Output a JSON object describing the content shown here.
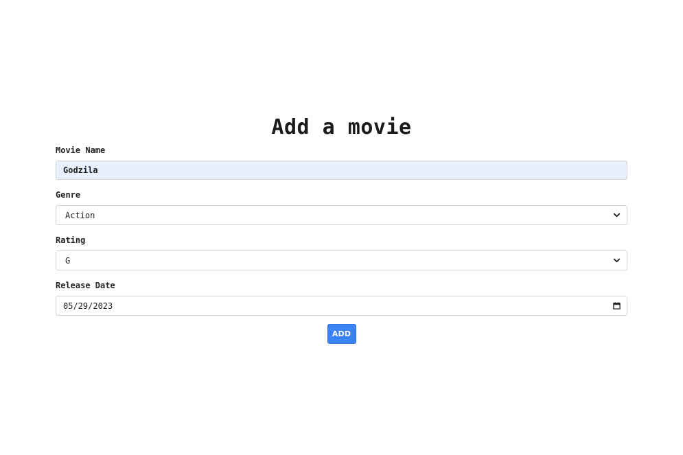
{
  "form": {
    "title": "Add a movie",
    "movie_name": {
      "label": "Movie Name",
      "value": "Godzila"
    },
    "genre": {
      "label": "Genre",
      "selected": "Action"
    },
    "rating": {
      "label": "Rating",
      "selected": "G"
    },
    "release_date": {
      "label": "Release Date",
      "value": "05/29/2023"
    },
    "submit_label": "ADD"
  },
  "icons": {
    "genre_dropdown": "chevron-down-icon",
    "rating_dropdown": "chevron-down-icon",
    "date_picker": "calendar-icon"
  },
  "colors": {
    "accent": "#3b82f6",
    "autofill_bg": "#e8f0fe",
    "border": "#cfd3d8"
  }
}
